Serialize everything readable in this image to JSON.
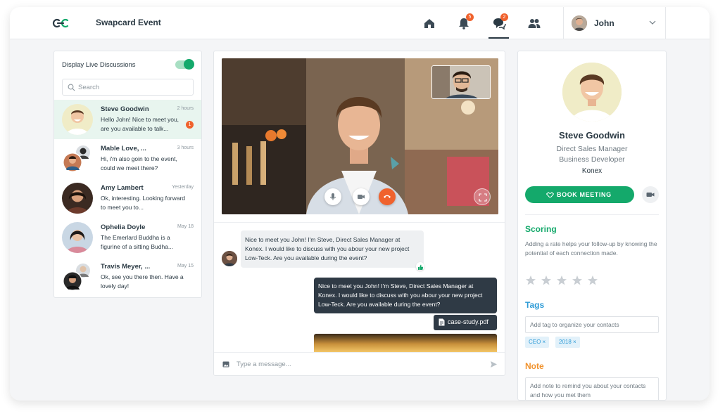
{
  "header": {
    "app_title": "Swapcard Event",
    "notification_count": "5",
    "chat_count": "2",
    "user_name": "John"
  },
  "sidebar": {
    "live_label": "Display Live Discussions",
    "search_placeholder": "Search",
    "conversations": [
      {
        "name": "Steve Goodwin",
        "time": "2 hours",
        "message": "Hello John! Nice to meet you, are you available to talk...",
        "unread": "1"
      },
      {
        "name": "Mable Love, ...",
        "time": "3 hours",
        "message": "Hi, i'm also goin to the event, could we meet there?"
      },
      {
        "name": "Amy Lambert",
        "time": "Yesterday",
        "message": "Ok, interesting. Looking forward to meet you to..."
      },
      {
        "name": "Ophelia Doyle",
        "time": "May 18",
        "message": "The Emerlard Buddha is a figurine of a sitting Budha..."
      },
      {
        "name": "Travis Meyer, ...",
        "time": "May 15",
        "message": "Ok, see you there then. Have a lovely day!"
      }
    ]
  },
  "chat": {
    "incoming_message": "Nice to meet you John! I'm Steve, Direct Sales Manager at Konex. I would like to discuss with you abour your new project Low-Teck. Are you available during the event?",
    "outgoing_message": "Nice to meet you John! I'm Steve, Direct Sales Manager at Konex. I would like to discuss with you abour your new project Low-Teck. Are you available during the event?",
    "file_name": "case-study.pdf",
    "composer_placeholder": "Type a message..."
  },
  "profile": {
    "name": "Steve Goodwin",
    "role_1": "Direct Sales Manager",
    "role_2": "Business Developer",
    "company": "Konex",
    "book_label": "BOOK MEETING",
    "scoring_title": "Scoring",
    "scoring_desc": "Adding a rate helps your follow-up by knowing the potential of each connection made.",
    "rating": 0,
    "rating_max": 5,
    "tags_title": "Tags",
    "tags_placeholder": "Add tag to organize your contacts",
    "tags": [
      "CEO ×",
      "2018 ×"
    ],
    "note_title": "Note",
    "note_placeholder": "Add note to remind you about your contacts and how you met them"
  },
  "colors": {
    "accent_green": "#14a96b",
    "accent_blue": "#2e9bd6",
    "accent_orange": "#f0922d",
    "badge_red": "#f0622d",
    "dark_bubble": "#2f3a45"
  },
  "icons": [
    "logo-icon",
    "home-icon",
    "bell-icon",
    "chat-icon",
    "people-icon",
    "chevron-down-icon",
    "search-icon",
    "mic-icon",
    "camera-icon",
    "hangup-icon",
    "fullscreen-icon",
    "like-icon",
    "file-icon",
    "image-icon",
    "send-icon",
    "handshake-icon",
    "video-icon",
    "star-icon"
  ]
}
